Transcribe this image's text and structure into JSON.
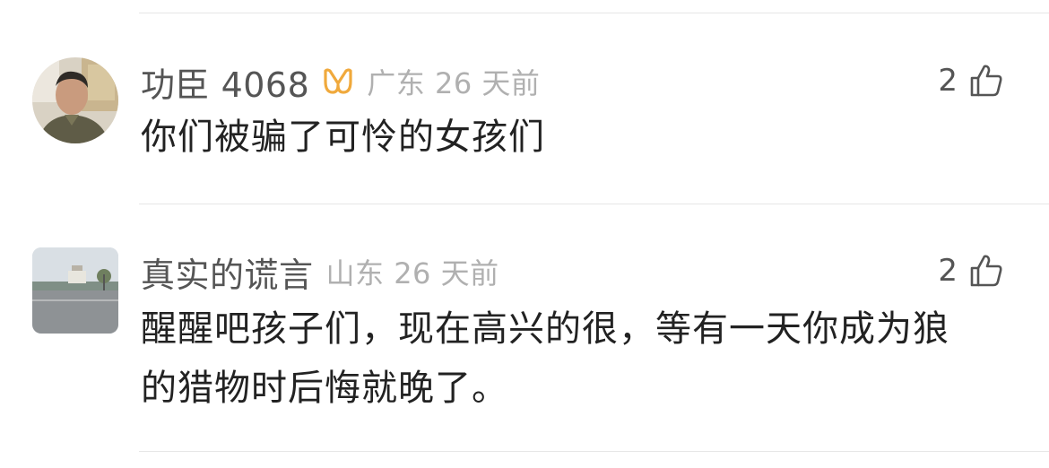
{
  "comments": [
    {
      "username": "功臣 4068",
      "badge_icon": "vip-badge-icon",
      "badge_color": "#f0a93c",
      "location": "广东",
      "time": "26 天前",
      "location_time": "广东 26 天前",
      "likes": "2",
      "text": "你们被骗了可怜的女孩们"
    },
    {
      "username": "真实的谎言",
      "location": "山东",
      "time": "26 天前",
      "location_time": "山东 26 天前",
      "likes": "2",
      "text": "醒醒吧孩子们，现在高兴的很，等有一天你成为狼的猎物时后悔就晚了。"
    }
  ],
  "like_icon": "thumbs-up-icon"
}
